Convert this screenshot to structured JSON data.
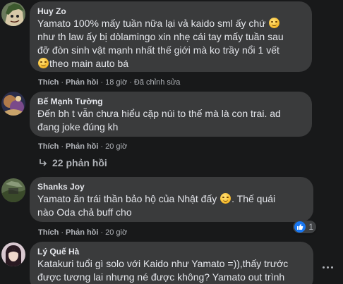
{
  "comments": [
    {
      "author": "Huy Zo",
      "lines": [
        "Yamato 100% mấy tuần nữa lại vả kaido sml ấy chứ",
        "như th law ấy bị dòlamingo xin nhẹ cái tay mấy tuần sau",
        "đỡ đòn sinh vật mạnh nhất thế giới mà ko trầy nổi 1 vết",
        "theo main auto bá"
      ],
      "actions": {
        "like": "Thích",
        "reply": "Phản hồi",
        "time": "18 giờ",
        "edited": "Đã chỉnh sửa"
      }
    },
    {
      "author": "Bế Mạnh Tường",
      "lines": [
        "Đến bh t vẫn chưa hiểu cặp núi to thế mà là con trai. ad",
        "đang joke đúng kh"
      ],
      "actions": {
        "like": "Thích",
        "reply": "Phản hồi",
        "time": "20 giờ"
      }
    },
    {
      "author": "Shanks Joy",
      "lines": [
        "Yamato ăn trái thần bảo hộ của Nhật đấy",
        ". Thế quái",
        "nào Oda chả buff cho"
      ],
      "actions": {
        "like": "Thích",
        "reply": "Phản hồi",
        "time": "20 giờ"
      },
      "reaction_count": "1"
    },
    {
      "author": "Lý Quế Hà",
      "lines": [
        "Katakuri tuổi gì solo với Kaido như Yamato =)),thấy trước",
        "được tương lai nhưng né được không? Yamato out trình"
      ]
    }
  ],
  "replies_link": "22 phản hồi",
  "icons": {
    "reply_arrow": "reply-arrow-icon",
    "like_reaction": "like-reaction-icon",
    "more": "more-options-icon"
  },
  "colors": {
    "background": "#18191a",
    "bubble": "#3a3b3c",
    "text": "#e4e6eb",
    "muted": "#b0b3b8",
    "like_blue": "#1877f2"
  }
}
